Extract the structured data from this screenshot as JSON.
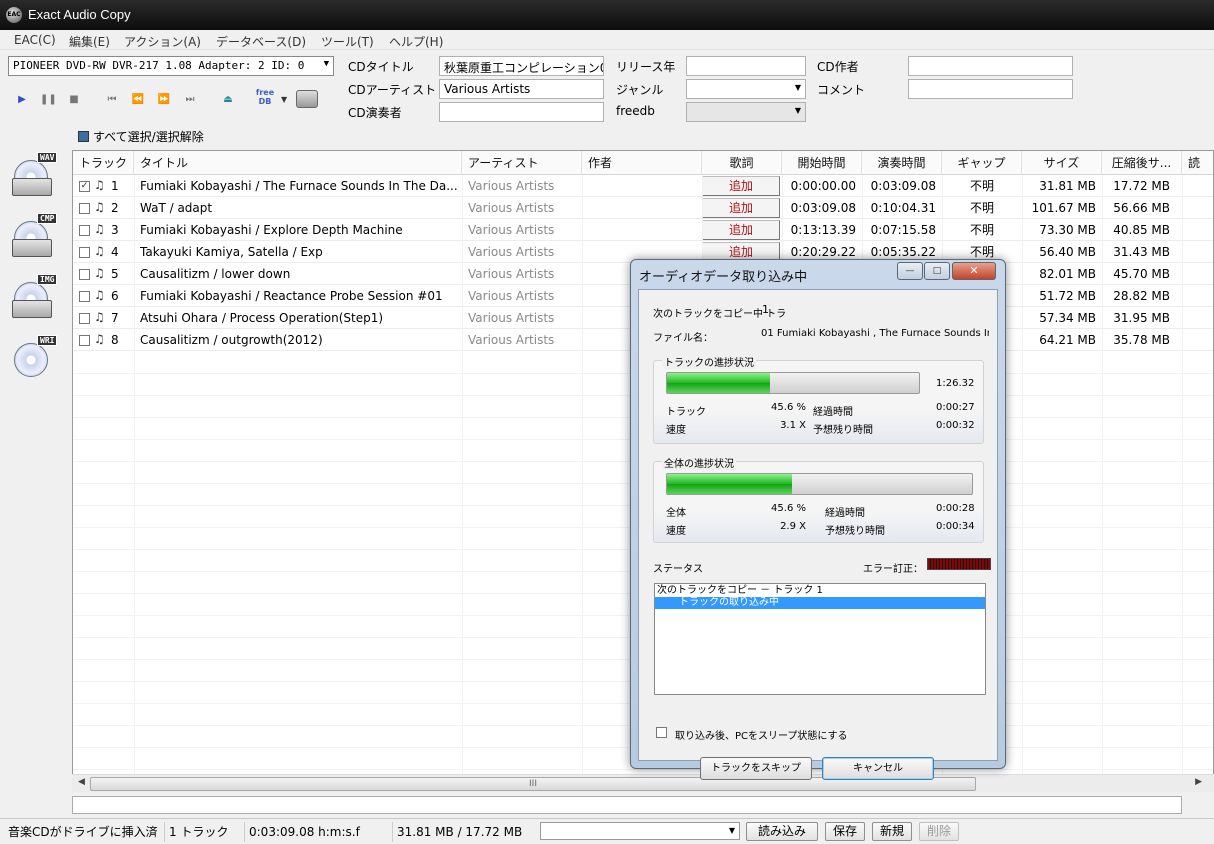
{
  "window": {
    "title": "Exact Audio Copy",
    "icon_label": "EAC"
  },
  "menu": [
    "EAC(C)",
    "編集(E)",
    "アクション(A)",
    "データベース(D)",
    "ツール(T)",
    "ヘルプ(H)"
  ],
  "drive": {
    "selected": "PIONEER DVD-RW  DVR-217 1.08   Adapter: 2  ID: 0"
  },
  "metadata": {
    "cd_title_label": "CDタイトル",
    "cd_title": "秋葉原重工コンピレーション01",
    "cd_artist_label": "CDアーティスト",
    "cd_artist": "Various Artists",
    "cd_performer_label": "CD演奏者",
    "cd_performer": "",
    "release_year_label": "リリース年",
    "release_year": "",
    "genre_label": "ジャンル",
    "genre": "",
    "freedb_label": "freedb",
    "freedb": "",
    "cd_author_label": "CD作者",
    "cd_author": "",
    "comment_label": "コメント",
    "comment": ""
  },
  "toolbar": {
    "freedb_button": "free\nDB"
  },
  "select_all_label": "すべて選択/選択解除",
  "sidebar": [
    {
      "name": "wav",
      "tag": "WAV"
    },
    {
      "name": "cmp",
      "tag": "CMP"
    },
    {
      "name": "img",
      "tag": "IMG"
    },
    {
      "name": "wri",
      "tag": "WRI"
    }
  ],
  "table": {
    "headers": [
      "トラック",
      "タイトル",
      "アーティスト",
      "作者",
      "歌詞",
      "開始時間",
      "演奏時間",
      "ギャップ",
      "サイズ",
      "圧縮後サ...",
      "読"
    ],
    "lyric_button": "追加",
    "rows": [
      {
        "checked": true,
        "track": "1",
        "title": "Fumiaki Kobayashi / The Furnace Sounds In The Da...",
        "artist": "Various Artists",
        "start": "0:00:00.00",
        "length": "0:03:09.08",
        "gap": "不明",
        "size": "31.81 MB",
        "compressed": "17.72 MB"
      },
      {
        "checked": false,
        "track": "2",
        "title": "WaT / adapt",
        "artist": "Various Artists",
        "start": "0:03:09.08",
        "length": "0:10:04.31",
        "gap": "不明",
        "size": "101.67 MB",
        "compressed": "56.66 MB"
      },
      {
        "checked": false,
        "track": "3",
        "title": "Fumiaki Kobayashi / Explore Depth Machine",
        "artist": "Various Artists",
        "start": "0:13:13.39",
        "length": "0:07:15.58",
        "gap": "不明",
        "size": "73.30 MB",
        "compressed": "40.85 MB"
      },
      {
        "checked": false,
        "track": "4",
        "title": "Takayuki Kamiya, Satella / Exp",
        "artist": "Various Artists",
        "start": "0:20:29.22",
        "length": "0:05:35.22",
        "gap": "不明",
        "size": "56.40 MB",
        "compressed": "31.43 MB"
      },
      {
        "checked": false,
        "track": "5",
        "title": "Causalitizm / lower down",
        "artist": "Various Artists",
        "start": "",
        "length": "",
        "gap": "",
        "size": "82.01 MB",
        "compressed": "45.70 MB"
      },
      {
        "checked": false,
        "track": "6",
        "title": "Fumiaki Kobayashi / Reactance Probe Session #01",
        "artist": "Various Artists",
        "start": "",
        "length": "",
        "gap": "",
        "size": "51.72 MB",
        "compressed": "28.82 MB"
      },
      {
        "checked": false,
        "track": "7",
        "title": "Atsuhi Ohara / Process Operation(Step1)",
        "artist": "Various Artists",
        "start": "",
        "length": "",
        "gap": "",
        "size": "57.34 MB",
        "compressed": "31.95 MB"
      },
      {
        "checked": false,
        "track": "8",
        "title": "Causalitizm / outgrowth(2012)",
        "artist": "Various Artists",
        "start": "",
        "length": "",
        "gap": "",
        "size": "64.21 MB",
        "compressed": "35.78 MB"
      }
    ]
  },
  "scrollbar": {
    "grip": "III"
  },
  "statusbar": {
    "status": "音楽CDがドライブに挿入済",
    "tracks": "1 トラック",
    "time": "0:03:09.08 h:m:s.f",
    "size": "31.81 MB /  17.72 MB",
    "read_button": "読み込み",
    "save_button": "保存",
    "new_button": "新規",
    "delete_button": "削除"
  },
  "dialog": {
    "title": "オーディオデータ取り込み中",
    "next_track_label": "次のトラックをコピー中 トラ",
    "next_track_value": "1",
    "filename_label": "ファイル名：",
    "filename_value": "01 Fumiaki Kobayashi , The Furnace Sounds In",
    "track_progress": {
      "legend": "トラックの進捗状況",
      "fraction": 0.41,
      "total_time": "1:26.32",
      "label1": "トラック",
      "percent": "45.6 %",
      "elapsed_label": "経過時間",
      "elapsed": "0:00:27",
      "label2": "速度",
      "speed": "3.1 X",
      "remaining_label": "予想残り時間",
      "remaining": "0:00:32"
    },
    "overall_progress": {
      "legend": "全体の進捗状況",
      "fraction": 0.41,
      "label1": "全体",
      "percent": "45.6 %",
      "elapsed_label": "経過時間",
      "elapsed": "0:00:28",
      "label2": "速度",
      "speed": "2.9 X",
      "remaining_label": "予想残り時間",
      "remaining": "0:00:34"
    },
    "status_label": "ステータス",
    "error_label": "エラー訂正：",
    "log": [
      "次のトラックをコピー － トラック  1",
      "トラックの取り込み中"
    ],
    "sleep_checkbox_label": "取り込み後、PCをスリープ状態にする",
    "skip_button": "トラックをスキップ",
    "cancel_button": "キャンセル"
  }
}
